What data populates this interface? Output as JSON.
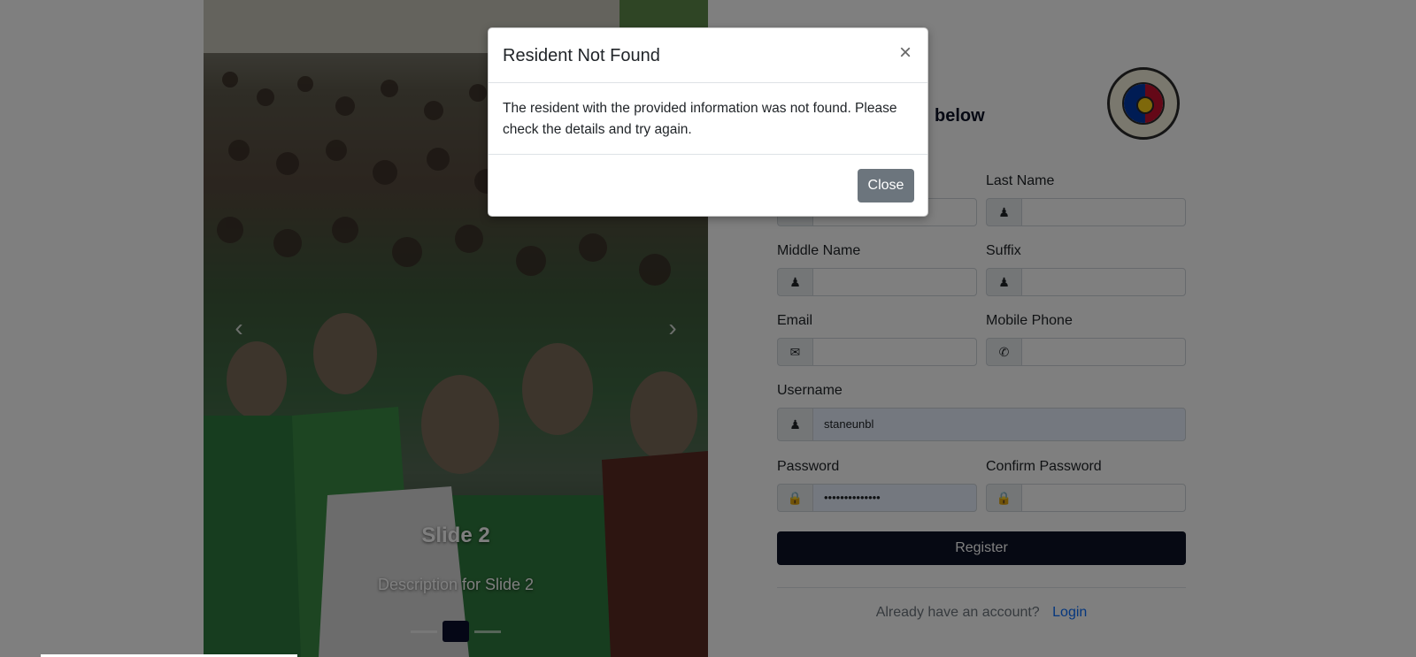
{
  "carousel": {
    "slide_title": "Slide 2",
    "slide_description": "Description for Slide 2",
    "prev_glyph": "‹",
    "next_glyph": "›"
  },
  "form": {
    "title_partial": "n",
    "subtitle_partial": "below",
    "fields": {
      "first_name": {
        "label": "",
        "value": ""
      },
      "last_name": {
        "label": "Last Name",
        "value": ""
      },
      "middle_name": {
        "label": "Middle Name",
        "value": ""
      },
      "suffix": {
        "label": "Suffix",
        "value": ""
      },
      "email": {
        "label": "Email",
        "value": ""
      },
      "mobile": {
        "label": "Mobile Phone",
        "value": ""
      },
      "username": {
        "label": "Username",
        "value": "staneunbl"
      },
      "password": {
        "label": "Password",
        "value": "••••••••••••••"
      },
      "confirm_password": {
        "label": "Confirm Password",
        "value": ""
      }
    },
    "register_label": "Register",
    "login_prompt": "Already have an account?",
    "login_link": "Login"
  },
  "modal": {
    "title": "Resident Not Found",
    "close_x": "×",
    "body": "The resident with the provided information was not found. Please check the details and try again.",
    "close_button": "Close"
  },
  "icons": {
    "user": "user-icon",
    "envelope": "envelope-icon",
    "phone": "phone-icon",
    "lock": "lock-icon"
  },
  "colors": {
    "primary_dark": "#0d1326",
    "secondary": "#6c757d",
    "link": "#0d6efd"
  }
}
